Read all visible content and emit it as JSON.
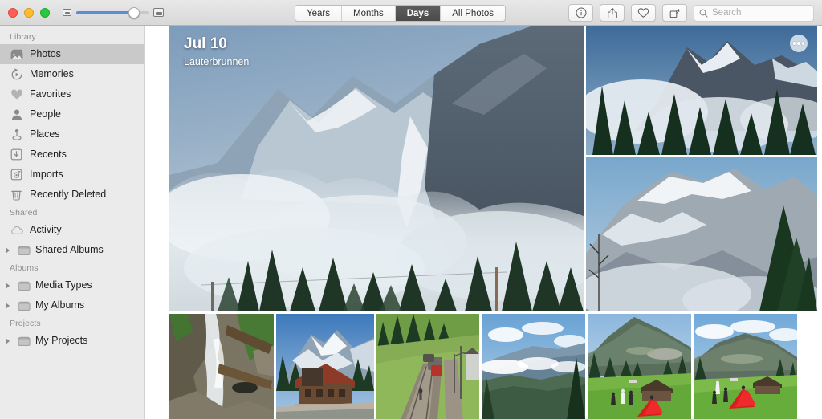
{
  "window": {
    "traffic_lights": [
      "close",
      "minimize",
      "maximize"
    ],
    "colors": {
      "close": "#ff5f57",
      "minimize": "#febc2e",
      "maximize": "#28c840",
      "slider_fill": "#5b8dd6",
      "sidebar_bg": "#ebebeb",
      "selected_row": "#c9c9c9",
      "segment_active": "#4f4f4f"
    }
  },
  "toolbar": {
    "zoom_slider": {
      "min_icon": "small-thumbnails-icon",
      "max_icon": "large-thumbnails-icon",
      "value_percent": 78
    },
    "segments": [
      {
        "label": "Years",
        "active": false
      },
      {
        "label": "Months",
        "active": false
      },
      {
        "label": "Days",
        "active": true
      },
      {
        "label": "All Photos",
        "active": false
      }
    ],
    "buttons": [
      {
        "name": "info-button",
        "icon": "info-circle-icon"
      },
      {
        "name": "share-button",
        "icon": "share-icon"
      },
      {
        "name": "favorite-button",
        "icon": "heart-icon"
      },
      {
        "name": "rotate-button",
        "icon": "rotate-icon"
      }
    ],
    "search": {
      "placeholder": "Search",
      "value": "",
      "icon": "search-icon"
    }
  },
  "sidebar": {
    "sections": [
      {
        "header": "Library",
        "items": [
          {
            "label": "Photos",
            "icon": "photos-icon",
            "selected": true,
            "disclosure": false
          },
          {
            "label": "Memories",
            "icon": "memories-icon",
            "selected": false,
            "disclosure": false
          },
          {
            "label": "Favorites",
            "icon": "heart-icon",
            "selected": false,
            "disclosure": false
          },
          {
            "label": "People",
            "icon": "person-icon",
            "selected": false,
            "disclosure": false
          },
          {
            "label": "Places",
            "icon": "pin-icon",
            "selected": false,
            "disclosure": false
          },
          {
            "label": "Recents",
            "icon": "recents-tray-icon",
            "selected": false,
            "disclosure": false
          },
          {
            "label": "Imports",
            "icon": "camera-icon",
            "selected": false,
            "disclosure": false
          },
          {
            "label": "Recently Deleted",
            "icon": "trash-icon",
            "selected": false,
            "disclosure": false
          }
        ]
      },
      {
        "header": "Shared",
        "items": [
          {
            "label": "Activity",
            "icon": "cloud-icon",
            "selected": false,
            "disclosure": false
          },
          {
            "label": "Shared Albums",
            "icon": "folder-icon",
            "selected": false,
            "disclosure": true
          }
        ]
      },
      {
        "header": "Albums",
        "items": [
          {
            "label": "Media Types",
            "icon": "folder-icon",
            "selected": false,
            "disclosure": true
          },
          {
            "label": "My Albums",
            "icon": "folder-icon",
            "selected": false,
            "disclosure": true
          }
        ]
      },
      {
        "header": "Projects",
        "items": [
          {
            "label": "My Projects",
            "icon": "folder-icon",
            "selected": false,
            "disclosure": true
          }
        ]
      }
    ]
  },
  "main": {
    "day_header": {
      "date": "Jul 10",
      "location": "Lauterbrunnen"
    },
    "more_button": {
      "name": "more-options-button",
      "icon": "ellipsis-icon"
    },
    "photos": [
      {
        "id": "hero",
        "alt": "Mountain valley with clouds and snowy peaks"
      },
      {
        "id": "top-right",
        "alt": "Mountain peak above evergreen trees"
      },
      {
        "id": "bottom-right",
        "alt": "Snow covered mountain with pine tree"
      },
      {
        "id": "thumb-1",
        "alt": "Waterfall over mossy rocks"
      },
      {
        "id": "thumb-2",
        "alt": "Alpine chalet with red roof and mountain"
      },
      {
        "id": "thumb-3",
        "alt": "Mountain railway with train"
      },
      {
        "id": "thumb-4",
        "alt": "Valley view with clouds"
      },
      {
        "id": "thumb-5",
        "alt": "Alpine meadow with people and red dress"
      },
      {
        "id": "thumb-6",
        "alt": "Alpine meadow with red dress and chalet"
      }
    ]
  }
}
